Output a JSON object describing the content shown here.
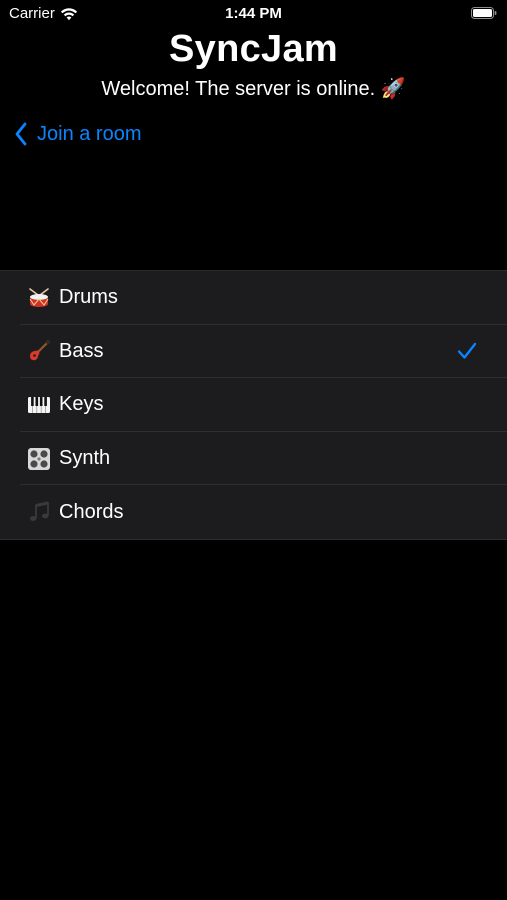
{
  "status_bar": {
    "carrier": "Carrier",
    "time": "1:44 PM"
  },
  "header": {
    "title": "SyncJam",
    "subtitle": "Welcome! The server is online. 🚀"
  },
  "navigation": {
    "back_label": "Join a room"
  },
  "instruments": [
    {
      "label": "Drums",
      "icon": "drum-icon",
      "selected": false
    },
    {
      "label": "Bass",
      "icon": "guitar-icon",
      "selected": true
    },
    {
      "label": "Keys",
      "icon": "piano-keys-icon",
      "selected": false
    },
    {
      "label": "Synth",
      "icon": "synth-icon",
      "selected": false
    },
    {
      "label": "Chords",
      "icon": "music-notes-icon",
      "selected": false
    }
  ],
  "colors": {
    "accent": "#0a84ff",
    "background": "#000000",
    "list_background": "#1c1c1e"
  }
}
